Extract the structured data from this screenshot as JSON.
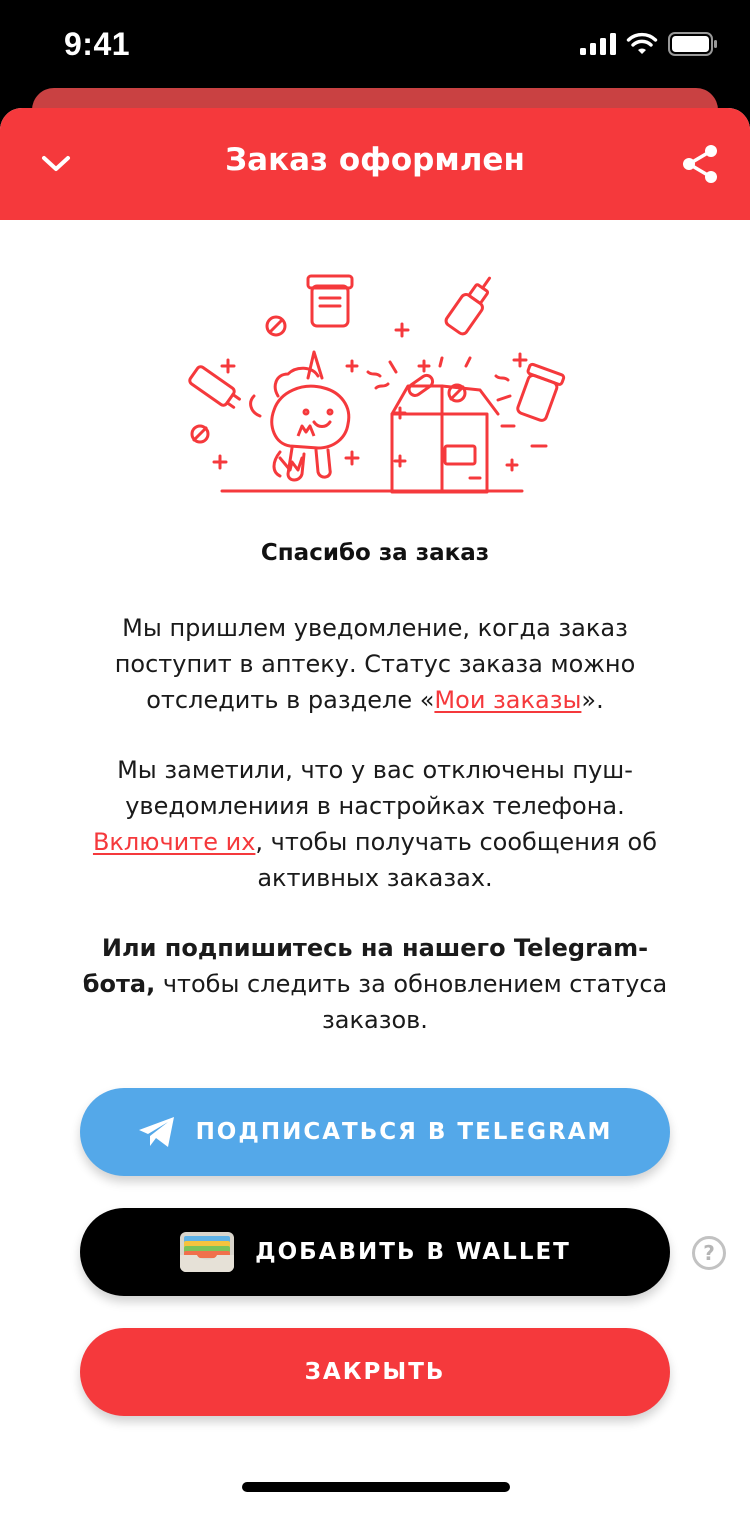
{
  "status_bar": {
    "time": "9:41"
  },
  "header": {
    "title": "Заказ оформлен"
  },
  "content": {
    "thanks_title": "Спасибо за заказ",
    "p1_before": "Мы пришлем уведомление, когда заказ поступит в аптеку. Статус заказа можно отследить в разделе «",
    "p1_link": "Мои заказы",
    "p1_after": "».",
    "p2_before": "Мы заметили, что у вас отключены пуш-уведомлениия в настройках телефона. ",
    "p2_link": "Включите их",
    "p2_after": ", чтобы получать сообщения об активных заказах.",
    "p3_bold": "Или подпишитесь на нашего Telegram-бота,",
    "p3_rest": " чтобы следить за обновлением статуса заказов."
  },
  "buttons": {
    "telegram": "ПОДПИСАТЬСЯ В TELEGRAM",
    "wallet": "ДОБАВИТЬ В WALLET",
    "close": "ЗАКРЫТЬ",
    "help": "?"
  },
  "icons": {
    "chevron": "chevron-down-icon",
    "share": "share-icon",
    "telegram": "telegram-icon",
    "wallet": "wallet-icon",
    "help": "help-icon"
  },
  "colors": {
    "accent": "#f5393c",
    "telegram": "#54a8e9",
    "wallet": "#000000",
    "back_card": "#c94142"
  }
}
